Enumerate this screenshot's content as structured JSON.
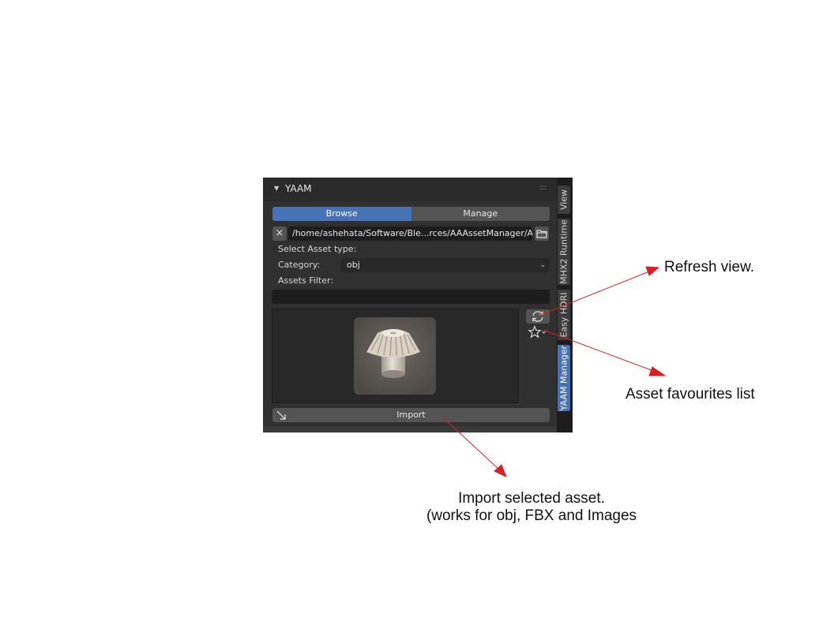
{
  "panel": {
    "title": "YAAM",
    "tabs": [
      {
        "label": "Browse",
        "active": true
      },
      {
        "label": "Manage",
        "active": false
      }
    ],
    "path": "/home/ashehata/Software/Ble...rces/AAAssetManager/Assets/",
    "select_asset_type_label": "Select Asset type:",
    "category_label": "Category:",
    "category_value": "obj",
    "assets_filter_label": "Assets Filter:",
    "assets_filter_value": "",
    "import_label": "Import"
  },
  "sidebar_tabs": [
    {
      "label": "View",
      "active": false
    },
    {
      "label": "MHX2 Runtime",
      "active": false
    },
    {
      "label": "Easy HDRI",
      "active": false
    },
    {
      "label": "YAAM Manager",
      "active": true
    }
  ],
  "annotations": {
    "refresh": "Refresh view.",
    "favourites": "Asset favourites list",
    "import_line1": "Import selected asset.",
    "import_line2": "(works for obj, FBX and Images"
  },
  "colors": {
    "accent": "#4772b3",
    "panel_bg": "#303030",
    "arrow": "#d91f26"
  }
}
